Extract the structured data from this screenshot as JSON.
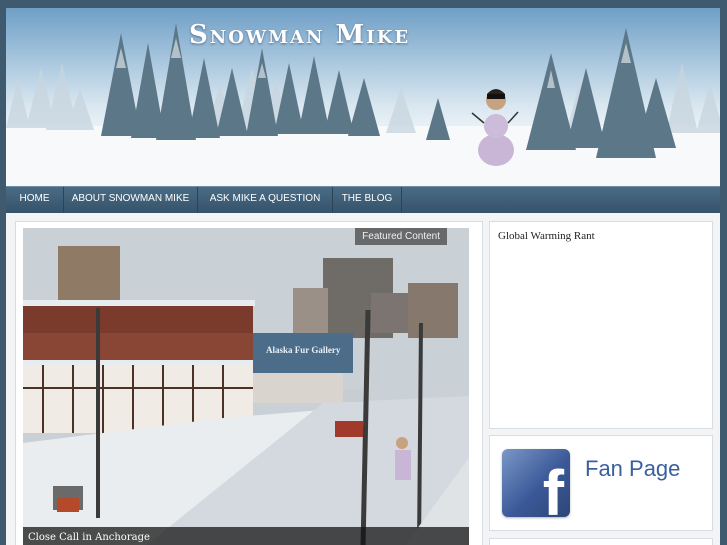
{
  "header": {
    "site_title": "Snowman Mike"
  },
  "nav": {
    "items": [
      "HOME",
      "ABOUT SNOWMAN MIKE",
      "ASK MIKE A QUESTION",
      "THE BLOG"
    ]
  },
  "featured": {
    "tag": "Featured Content",
    "caption": "Close Call in Anchorage",
    "sign_text": "Alaska Fur Gallery"
  },
  "sidebar": {
    "link": "Global Warming Rant",
    "fan_page_label": "Fan Page",
    "fb_letter": "f"
  },
  "colors": {
    "nav": "#3f5c74",
    "page_bg": "#3f5a6f",
    "fb_blue": "#3b5998",
    "fan_text": "#3b5f9f"
  }
}
